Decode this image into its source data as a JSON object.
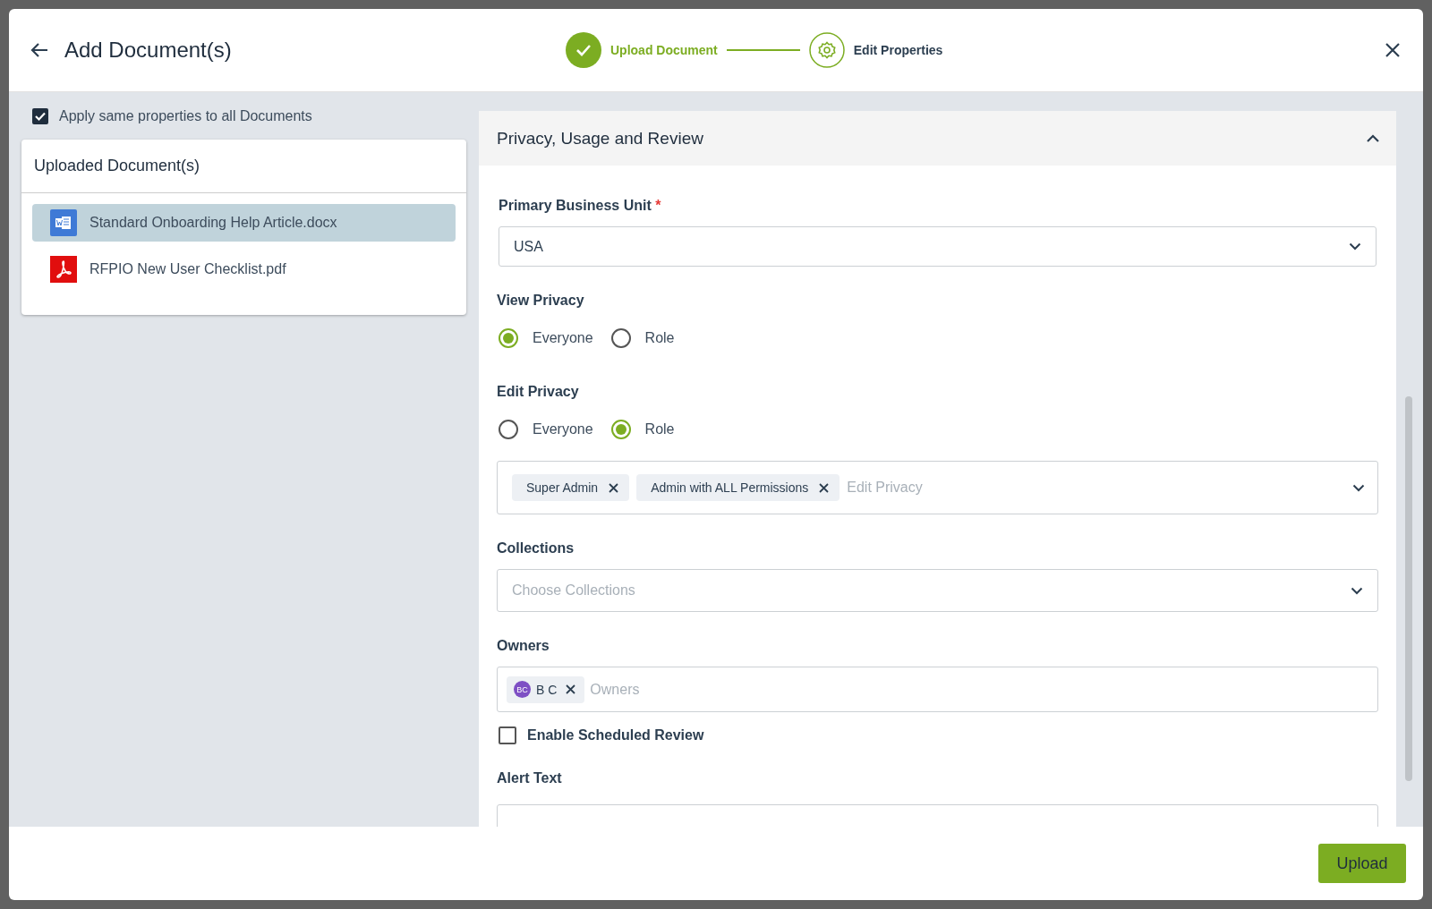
{
  "header": {
    "title": "Add Document(s)",
    "steps": [
      {
        "label": "Upload Document",
        "kind": "done"
      },
      {
        "label": "Edit Properties",
        "kind": "current"
      }
    ]
  },
  "apply_same": {
    "label": "Apply same properties to all Documents",
    "checked": true
  },
  "documents": {
    "title": "Uploaded Document(s)",
    "items": [
      {
        "name": "Standard Onboarding Help Article.docx",
        "kind": "word",
        "selected": true
      },
      {
        "name": "RFPIO New User Checklist.pdf",
        "kind": "pdf",
        "selected": false
      }
    ]
  },
  "section": {
    "title": "Privacy, Usage and Review",
    "expanded": true
  },
  "primary_business_unit": {
    "label": "Primary Business Unit",
    "required_mark": "*",
    "value": "USA"
  },
  "view_privacy": {
    "label": "View Privacy",
    "options": [
      {
        "label": "Everyone",
        "selected": true
      },
      {
        "label": "Role",
        "selected": false
      }
    ]
  },
  "edit_privacy": {
    "label": "Edit Privacy",
    "options": [
      {
        "label": "Everyone",
        "selected": false
      },
      {
        "label": "Role",
        "selected": true
      }
    ],
    "tags": [
      "Super Admin",
      "Admin with ALL Permissions"
    ],
    "placeholder": "Edit Privacy"
  },
  "collections": {
    "label": "Collections",
    "placeholder": "Choose Collections"
  },
  "owners": {
    "label": "Owners",
    "chips": [
      {
        "initials": "BC",
        "name": "B C"
      }
    ],
    "placeholder": "Owners"
  },
  "scheduled_review": {
    "label": "Enable Scheduled Review",
    "checked": false
  },
  "alert_text": {
    "label": "Alert Text"
  },
  "footer": {
    "button": "Upload"
  }
}
